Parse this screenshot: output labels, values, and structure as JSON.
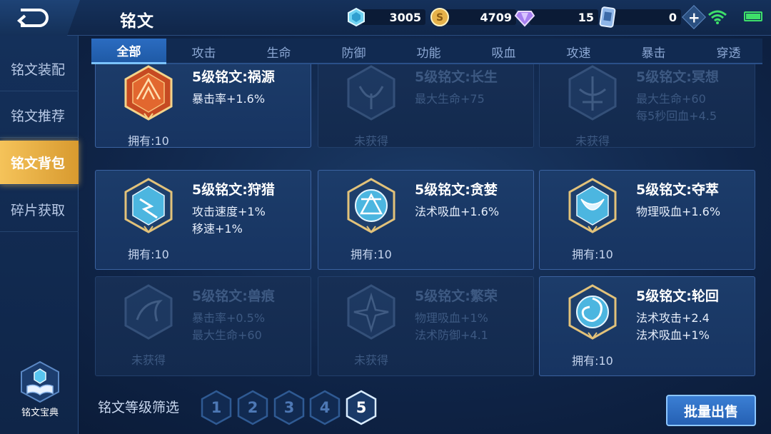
{
  "header": {
    "title": "铭文",
    "resources": [
      {
        "icon": "diamond-icon",
        "value": "3005"
      },
      {
        "icon": "gold-coin-icon",
        "value": "4709"
      },
      {
        "icon": "purple-crystal-icon",
        "value": "15"
      },
      {
        "icon": "rune-card-icon",
        "value": "0"
      }
    ]
  },
  "sidebar": {
    "items": [
      {
        "label": "铭文装配"
      },
      {
        "label": "铭文推荐"
      },
      {
        "label": "铭文背包",
        "active": true
      },
      {
        "label": "碎片获取"
      }
    ],
    "codex_label": "铭文宝典"
  },
  "tabs": [
    {
      "label": "全部",
      "active": true
    },
    {
      "label": "攻击"
    },
    {
      "label": "生命"
    },
    {
      "label": "防御"
    },
    {
      "label": "功能"
    },
    {
      "label": "吸血"
    },
    {
      "label": "攻速"
    },
    {
      "label": "暴击"
    },
    {
      "label": "穿透"
    }
  ],
  "cards": [
    {
      "name": "5级铭文:祸源",
      "stats": [
        "暴击率+1.6%"
      ],
      "owned": "拥有:10",
      "locked": false,
      "color": "#c64a22"
    },
    {
      "name": "5级铭文:长生",
      "stats": [
        "最大生命+75"
      ],
      "owned": "未获得",
      "locked": true,
      "color": "#4a8fc5"
    },
    {
      "name": "5级铭文:冥想",
      "stats": [
        "最大生命+60",
        "每5秒回血+4.5"
      ],
      "owned": "未获得",
      "locked": true,
      "color": "#4a8fc5"
    },
    {
      "name": "5级铭文:狩猎",
      "stats": [
        "攻击速度+1%",
        "移速+1%"
      ],
      "owned": "拥有:10",
      "locked": false,
      "color": "#3fa9d8"
    },
    {
      "name": "5级铭文:贪婪",
      "stats": [
        "法术吸血+1.6%"
      ],
      "owned": "拥有:10",
      "locked": false,
      "color": "#3fa9d8"
    },
    {
      "name": "5级铭文:夺萃",
      "stats": [
        "物理吸血+1.6%"
      ],
      "owned": "拥有:10",
      "locked": false,
      "color": "#3fa9d8"
    },
    {
      "name": "5级铭文:兽痕",
      "stats": [
        "暴击率+0.5%",
        "最大生命+60"
      ],
      "owned": "未获得",
      "locked": true,
      "color": "#4a8fc5"
    },
    {
      "name": "5级铭文:繁荣",
      "stats": [
        "物理吸血+1%",
        "法术防御+4.1"
      ],
      "owned": "未获得",
      "locked": true,
      "color": "#4a8fc5"
    },
    {
      "name": "5级铭文:轮回",
      "stats": [
        "法术攻击+2.4",
        "法术吸血+1%"
      ],
      "owned": "拥有:10",
      "locked": false,
      "color": "#3fa9d8"
    }
  ],
  "filter": {
    "label": "铭文等级筛选",
    "levels": [
      "1",
      "2",
      "3",
      "4",
      "5"
    ],
    "selected": "5"
  },
  "sell_button": "批量出售"
}
